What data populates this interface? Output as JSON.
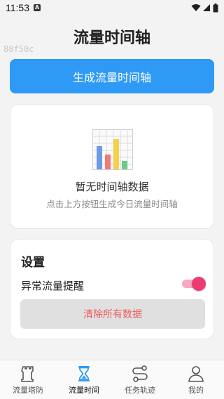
{
  "status_bar": {
    "time": "11:53",
    "notification_letter": "A"
  },
  "header": {
    "title": "流量时间轴",
    "debug_tag": "88f50c"
  },
  "actions": {
    "generate_label": "生成流量时间轴"
  },
  "empty_state": {
    "title": "暂无时间轴数据",
    "subtitle": "点击上方按钮生成今日流量时间轴",
    "icon": "bar-chart-icon"
  },
  "settings": {
    "title": "设置",
    "abnormal_alert_label": "异常流量提醒",
    "abnormal_alert_on": true,
    "clear_label": "清除所有数据"
  },
  "nav": {
    "items": [
      {
        "label": "流量塔防",
        "icon": "tower-icon",
        "active": false
      },
      {
        "label": "流量时间",
        "icon": "hourglass-icon",
        "active": true
      },
      {
        "label": "任务轨迹",
        "icon": "route-icon",
        "active": false
      },
      {
        "label": "我的",
        "icon": "person-icon",
        "active": false
      }
    ]
  },
  "colors": {
    "primary": "#2f9af5",
    "toggle_on": "#ee3a73",
    "danger_text": "#ef5b5b",
    "active_nav_icon": "#2f9af5"
  }
}
